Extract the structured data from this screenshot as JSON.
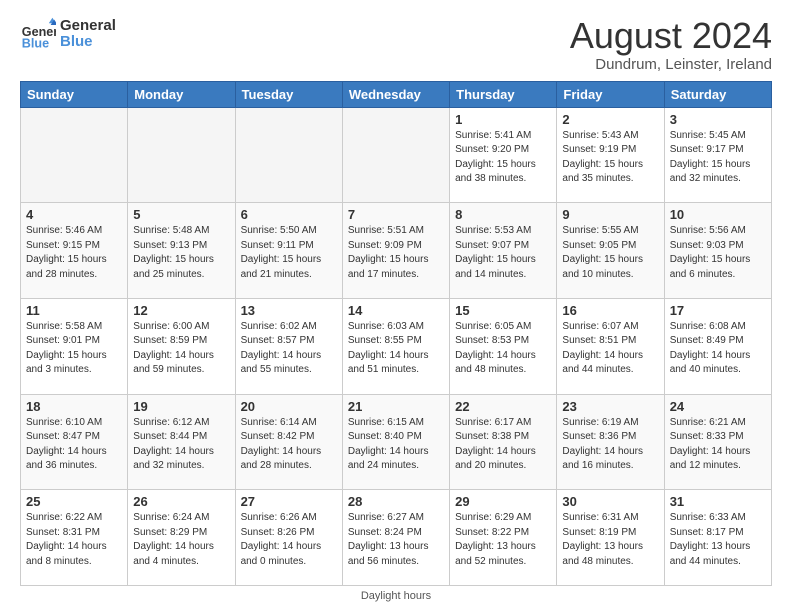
{
  "header": {
    "logo_line1": "General",
    "logo_line2": "Blue",
    "main_title": "August 2024",
    "subtitle": "Dundrum, Leinster, Ireland"
  },
  "calendar": {
    "days_of_week": [
      "Sunday",
      "Monday",
      "Tuesday",
      "Wednesday",
      "Thursday",
      "Friday",
      "Saturday"
    ],
    "weeks": [
      [
        {
          "day": "",
          "info": "",
          "empty": true
        },
        {
          "day": "",
          "info": "",
          "empty": true
        },
        {
          "day": "",
          "info": "",
          "empty": true
        },
        {
          "day": "",
          "info": "",
          "empty": true
        },
        {
          "day": "1",
          "info": "Sunrise: 5:41 AM\nSunset: 9:20 PM\nDaylight: 15 hours\nand 38 minutes."
        },
        {
          "day": "2",
          "info": "Sunrise: 5:43 AM\nSunset: 9:19 PM\nDaylight: 15 hours\nand 35 minutes."
        },
        {
          "day": "3",
          "info": "Sunrise: 5:45 AM\nSunset: 9:17 PM\nDaylight: 15 hours\nand 32 minutes."
        }
      ],
      [
        {
          "day": "4",
          "info": "Sunrise: 5:46 AM\nSunset: 9:15 PM\nDaylight: 15 hours\nand 28 minutes."
        },
        {
          "day": "5",
          "info": "Sunrise: 5:48 AM\nSunset: 9:13 PM\nDaylight: 15 hours\nand 25 minutes."
        },
        {
          "day": "6",
          "info": "Sunrise: 5:50 AM\nSunset: 9:11 PM\nDaylight: 15 hours\nand 21 minutes."
        },
        {
          "day": "7",
          "info": "Sunrise: 5:51 AM\nSunset: 9:09 PM\nDaylight: 15 hours\nand 17 minutes."
        },
        {
          "day": "8",
          "info": "Sunrise: 5:53 AM\nSunset: 9:07 PM\nDaylight: 15 hours\nand 14 minutes."
        },
        {
          "day": "9",
          "info": "Sunrise: 5:55 AM\nSunset: 9:05 PM\nDaylight: 15 hours\nand 10 minutes."
        },
        {
          "day": "10",
          "info": "Sunrise: 5:56 AM\nSunset: 9:03 PM\nDaylight: 15 hours\nand 6 minutes."
        }
      ],
      [
        {
          "day": "11",
          "info": "Sunrise: 5:58 AM\nSunset: 9:01 PM\nDaylight: 15 hours\nand 3 minutes."
        },
        {
          "day": "12",
          "info": "Sunrise: 6:00 AM\nSunset: 8:59 PM\nDaylight: 14 hours\nand 59 minutes."
        },
        {
          "day": "13",
          "info": "Sunrise: 6:02 AM\nSunset: 8:57 PM\nDaylight: 14 hours\nand 55 minutes."
        },
        {
          "day": "14",
          "info": "Sunrise: 6:03 AM\nSunset: 8:55 PM\nDaylight: 14 hours\nand 51 minutes."
        },
        {
          "day": "15",
          "info": "Sunrise: 6:05 AM\nSunset: 8:53 PM\nDaylight: 14 hours\nand 48 minutes."
        },
        {
          "day": "16",
          "info": "Sunrise: 6:07 AM\nSunset: 8:51 PM\nDaylight: 14 hours\nand 44 minutes."
        },
        {
          "day": "17",
          "info": "Sunrise: 6:08 AM\nSunset: 8:49 PM\nDaylight: 14 hours\nand 40 minutes."
        }
      ],
      [
        {
          "day": "18",
          "info": "Sunrise: 6:10 AM\nSunset: 8:47 PM\nDaylight: 14 hours\nand 36 minutes."
        },
        {
          "day": "19",
          "info": "Sunrise: 6:12 AM\nSunset: 8:44 PM\nDaylight: 14 hours\nand 32 minutes."
        },
        {
          "day": "20",
          "info": "Sunrise: 6:14 AM\nSunset: 8:42 PM\nDaylight: 14 hours\nand 28 minutes."
        },
        {
          "day": "21",
          "info": "Sunrise: 6:15 AM\nSunset: 8:40 PM\nDaylight: 14 hours\nand 24 minutes."
        },
        {
          "day": "22",
          "info": "Sunrise: 6:17 AM\nSunset: 8:38 PM\nDaylight: 14 hours\nand 20 minutes."
        },
        {
          "day": "23",
          "info": "Sunrise: 6:19 AM\nSunset: 8:36 PM\nDaylight: 14 hours\nand 16 minutes."
        },
        {
          "day": "24",
          "info": "Sunrise: 6:21 AM\nSunset: 8:33 PM\nDaylight: 14 hours\nand 12 minutes."
        }
      ],
      [
        {
          "day": "25",
          "info": "Sunrise: 6:22 AM\nSunset: 8:31 PM\nDaylight: 14 hours\nand 8 minutes."
        },
        {
          "day": "26",
          "info": "Sunrise: 6:24 AM\nSunset: 8:29 PM\nDaylight: 14 hours\nand 4 minutes."
        },
        {
          "day": "27",
          "info": "Sunrise: 6:26 AM\nSunset: 8:26 PM\nDaylight: 14 hours\nand 0 minutes."
        },
        {
          "day": "28",
          "info": "Sunrise: 6:27 AM\nSunset: 8:24 PM\nDaylight: 13 hours\nand 56 minutes."
        },
        {
          "day": "29",
          "info": "Sunrise: 6:29 AM\nSunset: 8:22 PM\nDaylight: 13 hours\nand 52 minutes."
        },
        {
          "day": "30",
          "info": "Sunrise: 6:31 AM\nSunset: 8:19 PM\nDaylight: 13 hours\nand 48 minutes."
        },
        {
          "day": "31",
          "info": "Sunrise: 6:33 AM\nSunset: 8:17 PM\nDaylight: 13 hours\nand 44 minutes."
        }
      ]
    ],
    "footer": "Daylight hours"
  }
}
